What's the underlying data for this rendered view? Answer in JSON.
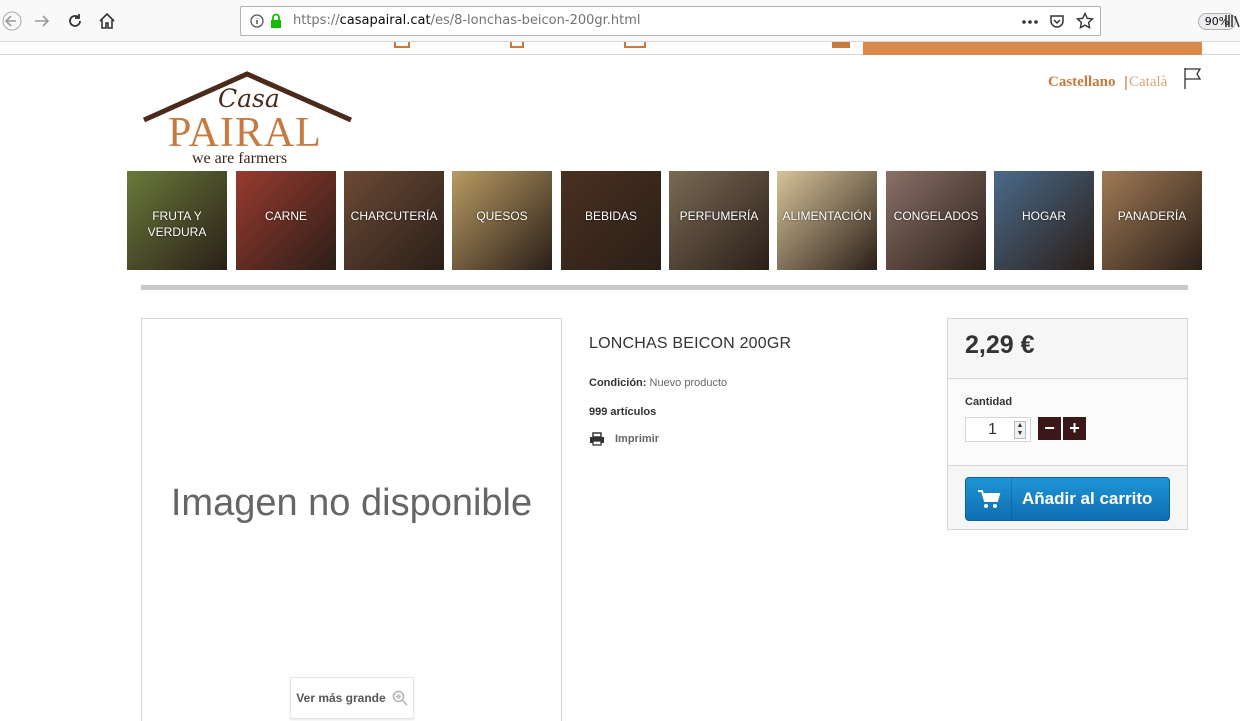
{
  "browser": {
    "url_scheme": "https://",
    "url_host": "casapairal.cat",
    "url_path": "/es/8-lonchas-beicon-200gr.html",
    "zoom": "90%"
  },
  "logo": {
    "casa": "Casa",
    "pairal": "PAIRAL",
    "tagline": "we are farmers"
  },
  "languages": {
    "active": "Castellano",
    "separator": "|",
    "other": "Català"
  },
  "categories": [
    {
      "label": "FRUTA Y VERDURA",
      "color": "#6a7a3a"
    },
    {
      "label": "CARNE",
      "color": "#9a3a2e"
    },
    {
      "label": "CHARCUTERÍA",
      "color": "#6b4a35"
    },
    {
      "label": "QUESOS",
      "color": "#b89a62"
    },
    {
      "label": "BEBIDAS",
      "color": "#4a3020"
    },
    {
      "label": "PERFUMERÍA",
      "color": "#7a6a55"
    },
    {
      "label": "ALIMENTACIÓN",
      "color": "#d8c49a"
    },
    {
      "label": "CONGELADOS",
      "color": "#8a7068"
    },
    {
      "label": "HOGAR",
      "color": "#4a6a8a"
    },
    {
      "label": "PANADERÍA",
      "color": "#a07a55"
    }
  ],
  "product": {
    "image_placeholder": "Imagen no disponible",
    "zoom_label": "Ver más grande",
    "title": "LONCHAS BEICON 200GR",
    "condition_label": "Condición:",
    "condition_value": "Nuevo producto",
    "stock": "999 artículos",
    "print_label": "Imprimir"
  },
  "buy_box": {
    "price": "2,29 €",
    "qty_label": "Cantidad",
    "qty_value": "1",
    "minus": "−",
    "plus": "+",
    "add_to_cart": "Añadir al carrito",
    "button_color": "#1a87c9"
  }
}
